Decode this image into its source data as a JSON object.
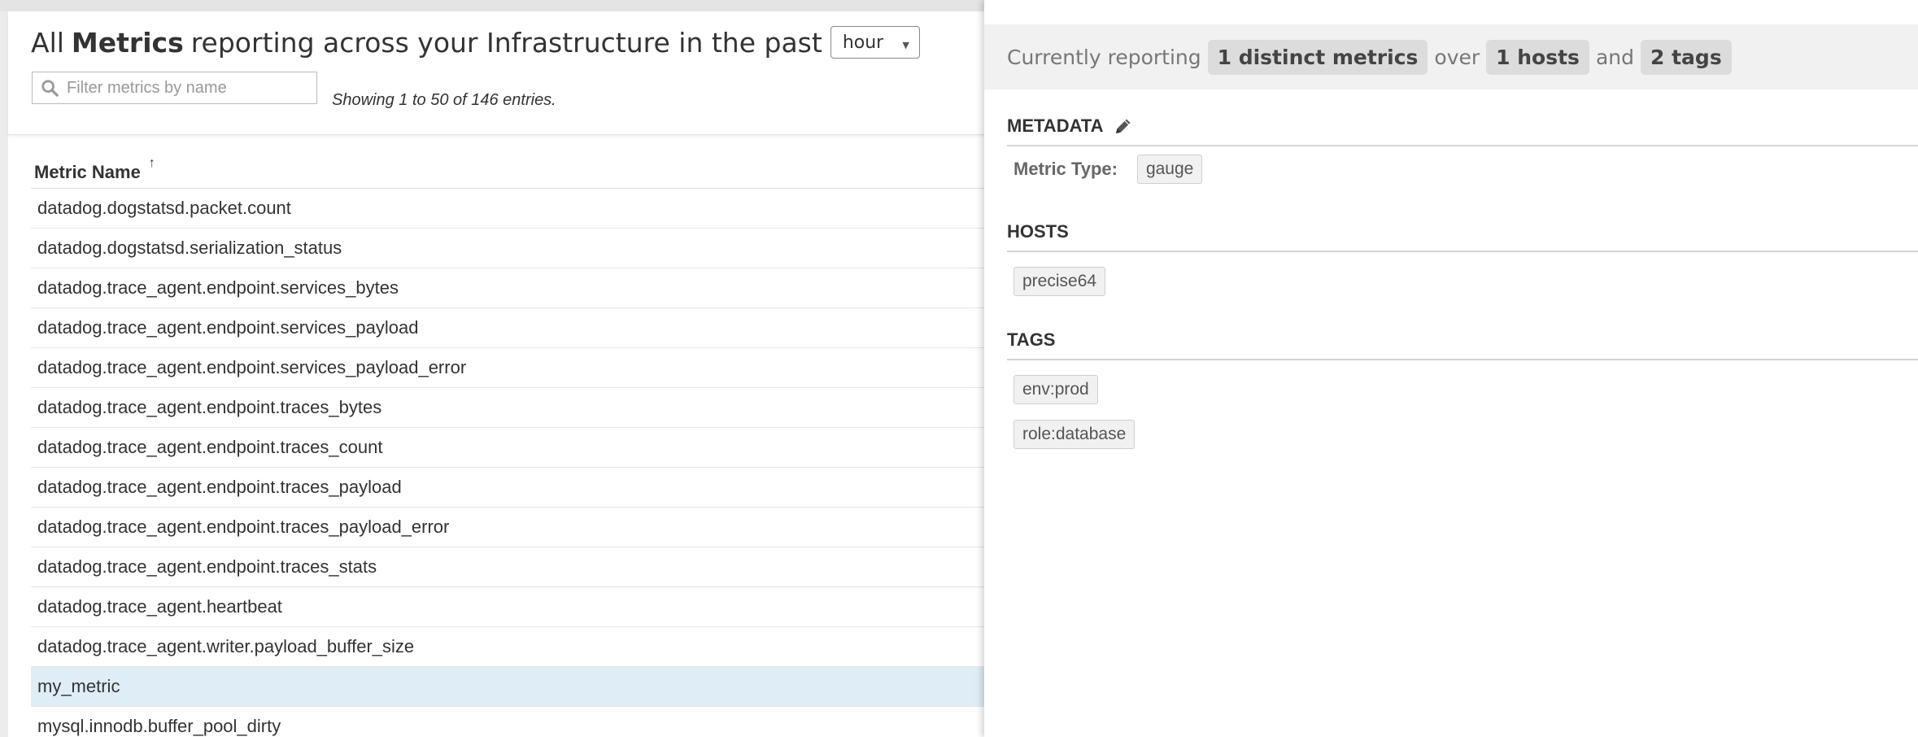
{
  "header": {
    "title_prefix": "All",
    "title_bold": "Metrics",
    "title_suffix": "reporting across your Infrastructure in the past",
    "period_value": "hour"
  },
  "filter": {
    "placeholder": "Filter metrics by name",
    "value": ""
  },
  "entries_info": "Showing 1 to 50 of 146 entries.",
  "table": {
    "column_header": "Metric Name",
    "sort_indicator": "↑",
    "selected_index": 12,
    "rows": [
      "datadog.dogstatsd.packet.count",
      "datadog.dogstatsd.serialization_status",
      "datadog.trace_agent.endpoint.services_bytes",
      "datadog.trace_agent.endpoint.services_payload",
      "datadog.trace_agent.endpoint.services_payload_error",
      "datadog.trace_agent.endpoint.traces_bytes",
      "datadog.trace_agent.endpoint.traces_count",
      "datadog.trace_agent.endpoint.traces_payload",
      "datadog.trace_agent.endpoint.traces_payload_error",
      "datadog.trace_agent.endpoint.traces_stats",
      "datadog.trace_agent.heartbeat",
      "datadog.trace_agent.writer.payload_buffer_size",
      "my_metric",
      "mysql.innodb.buffer_pool_dirty"
    ]
  },
  "panel": {
    "summary": {
      "lead": "Currently reporting",
      "metrics_pill": "1 distinct metrics",
      "over": "over",
      "hosts_pill": "1 hosts",
      "and": "and",
      "tags_pill": "2 tags"
    },
    "metadata_heading": "METADATA",
    "metric_type_label": "Metric Type:",
    "metric_type_value": "gauge",
    "hosts_heading": "HOSTS",
    "hosts": [
      "precise64"
    ],
    "tags_heading": "TAGS",
    "tags": [
      "env:prod",
      "role:database"
    ]
  },
  "colors": {
    "selected_row": "#deedf6",
    "pill_bg": "#dcdcdc",
    "summary_bg": "#f1f1f1"
  },
  "icons": {
    "search": "search-icon",
    "edit": "pencil-icon",
    "dropdown": "caret-down-icon"
  }
}
